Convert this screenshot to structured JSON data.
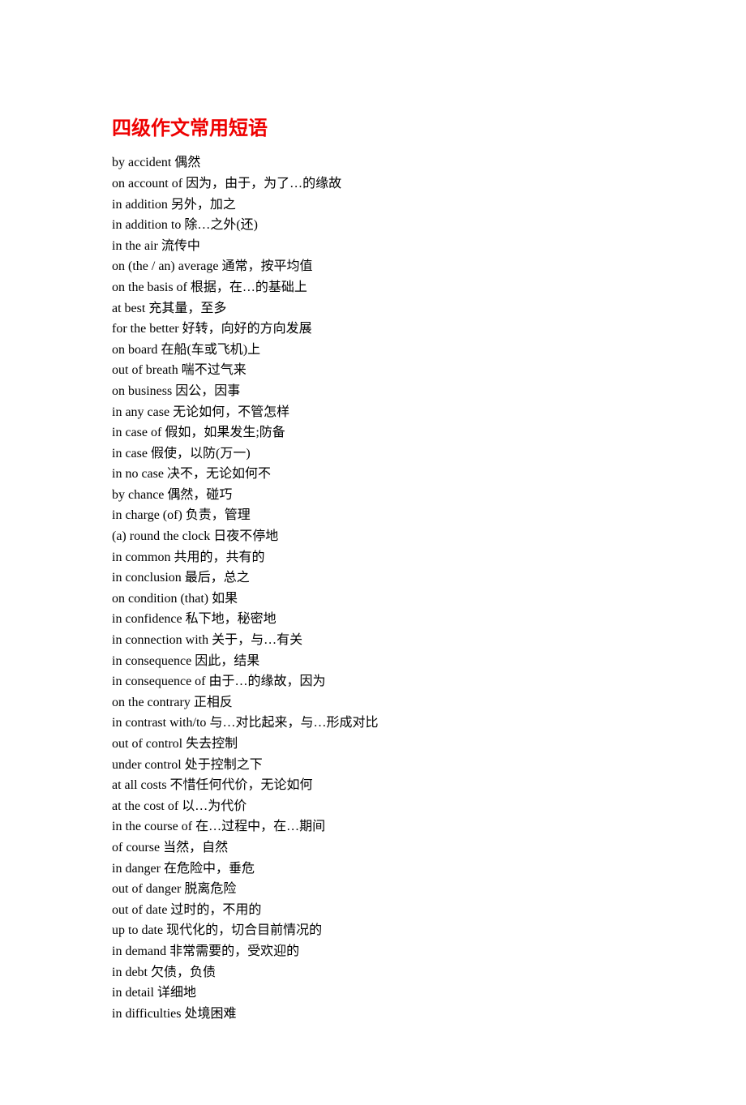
{
  "title": "四级作文常用短语",
  "phrases": [
    {
      "en": "by accident",
      "cn": " 偶然"
    },
    {
      "en": "on account of",
      "cn": " 因为，由于，为了…的缘故"
    },
    {
      "en": "in addition",
      "cn": " 另外，加之"
    },
    {
      "en": "in addition to",
      "cn": " 除…之外(还)"
    },
    {
      "en": "in the air",
      "cn": " 流传中"
    },
    {
      "en": "on (the / an) average",
      "cn": " 通常，按平均值"
    },
    {
      "en": "on the basis of",
      "cn": " 根据，在…的基础上"
    },
    {
      "en": "at best",
      "cn": " 充其量，至多"
    },
    {
      "en": "for the better",
      "cn": " 好转，向好的方向发展"
    },
    {
      "en": "on board",
      "cn": " 在船(车或飞机)上"
    },
    {
      "en": "out of breath",
      "cn": " 喘不过气来"
    },
    {
      "en": "on business",
      "cn": " 因公，因事"
    },
    {
      "en": "in any case",
      "cn": " 无论如何，不管怎样"
    },
    {
      "en": "in case of",
      "cn": " 假如，如果发生;防备"
    },
    {
      "en": "in case",
      "cn": " 假使，以防(万一)"
    },
    {
      "en": "in no case",
      "cn": " 决不，无论如何不"
    },
    {
      "en": "by chance",
      "cn": " 偶然，碰巧"
    },
    {
      "en": "in charge (of)",
      "cn": " 负责，管理"
    },
    {
      "en": "(a) round the clock",
      "cn": " 日夜不停地"
    },
    {
      "en": "in common",
      "cn": " 共用的，共有的"
    },
    {
      "en": "in conclusion",
      "cn": " 最后，总之"
    },
    {
      "en": "on condition (that)",
      "cn": " 如果"
    },
    {
      "en": "in confidence",
      "cn": " 私下地，秘密地"
    },
    {
      "en": "in connection with",
      "cn": " 关于，与…有关"
    },
    {
      "en": "in consequence",
      "cn": " 因此，结果"
    },
    {
      "en": "in consequence of",
      "cn": " 由于…的缘故，因为"
    },
    {
      "en": "on the contrary",
      "cn": " 正相反"
    },
    {
      "en": "in contrast with/to",
      "cn": " 与…对比起来，与…形成对比"
    },
    {
      "en": "out of control",
      "cn": " 失去控制"
    },
    {
      "en": "under control",
      "cn": " 处于控制之下"
    },
    {
      "en": "at all costs",
      "cn": " 不惜任何代价，无论如何"
    },
    {
      "en": "at the cost of",
      "cn": " 以…为代价"
    },
    {
      "en": "in the course of",
      "cn": " 在…过程中，在…期间"
    },
    {
      "en": "of course",
      "cn": " 当然，自然"
    },
    {
      "en": "in danger",
      "cn": " 在危险中，垂危"
    },
    {
      "en": "out of danger",
      "cn": " 脱离危险"
    },
    {
      "en": "out of date",
      "cn": " 过时的，不用的"
    },
    {
      "en": "up to date",
      "cn": " 现代化的，切合目前情况的"
    },
    {
      "en": "in demand",
      "cn": " 非常需要的，受欢迎的"
    },
    {
      "en": "in debt",
      "cn": " 欠债，负债"
    },
    {
      "en": "in detail",
      "cn": " 详细地"
    },
    {
      "en": "in difficulties",
      "cn": " 处境困难"
    }
  ]
}
